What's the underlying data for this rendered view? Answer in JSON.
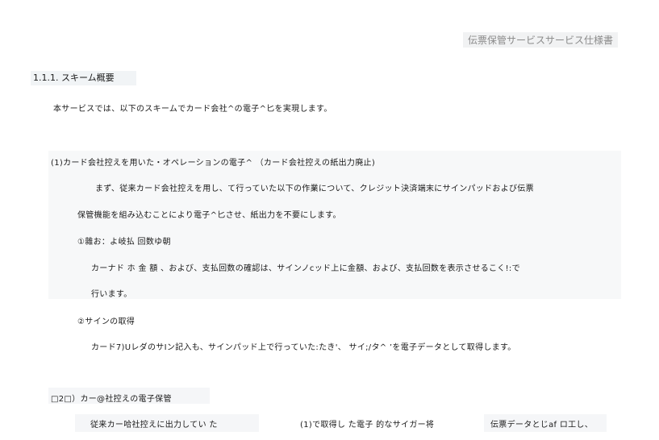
{
  "doc": {
    "header_title": "伝票保管サービスサービス仕様書",
    "section_heading": "1.1.1. スキーム概要",
    "intro": "本サービスでは、以下のスキームでカード会社^の電子^匕を実現します。",
    "sub1_title": "(1)カード会社控えを用いた・オペレーションの電子^ （カード会社控えの紙出力廃止)",
    "sub1_line1": "まず、従来カード会社控えを用し、て行っていた以下の作業について、クレジット決済端末にサインパッドおよび伝票",
    "sub1_line2": "保管機能を組み込むことにより電子^匕させ、紙出力を不要にします。",
    "item1_title": "①雜お：よ岐払 回数ゆ朝",
    "item1_line1": "カーナド ホ 金 額 、および、支払回数の確認は、サインノcッド上に金額、および、支払回数を表示させるこく!:で",
    "item1_line2": "行います。",
    "item2_title": "②サインの取得",
    "item2_line1": "カード7)UレダのサIン記入も、サインパッド上で行っていた:たき'、 サイ;/タ^ ’を電子データとして取得します。",
    "sub2_title": "□2□）カー@社控えの電子保管",
    "bottom_left": "従来カー哈社控えに出力してい た",
    "bottom_mid": "(1)で取得し た電子 的なサイガー将",
    "bottom_right": "伝票データとじaf ロ工し、"
  }
}
